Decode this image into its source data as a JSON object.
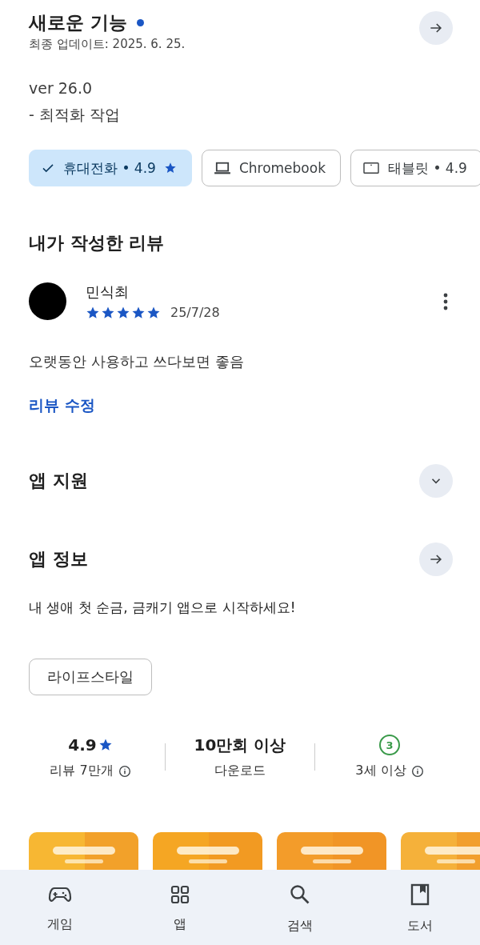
{
  "whats_new": {
    "title": "새로운 기능",
    "updated": "최종 업데이트: 2025. 6. 25.",
    "notes": [
      "ver 26.0",
      "- 최적화 작업"
    ]
  },
  "device_chips": [
    {
      "label": "휴대전화 • 4.9",
      "kind": "phone",
      "selected": true
    },
    {
      "label": "Chromebook",
      "kind": "laptop",
      "selected": false
    },
    {
      "label": "태블릿 • 4.9",
      "kind": "tablet",
      "selected": false
    }
  ],
  "my_review": {
    "heading": "내가 작성한 리뷰",
    "author": "민식최",
    "stars": 5,
    "date": "25/7/28",
    "text": "오랫동안 사용하고 쓰다보면 좋음",
    "edit_link": "리뷰 수정"
  },
  "sections": [
    {
      "title": "앱 지원",
      "kind": "expand"
    },
    {
      "title": "앱 정보",
      "kind": "arrow"
    }
  ],
  "description": "내 생애 첫 순금, 금캐기 앱으로 시작하세요!",
  "category_chip": "라이프스타일",
  "stats": [
    {
      "kind": "rating",
      "value": "4.9",
      "label": "리뷰 7만개"
    },
    {
      "kind": "plain",
      "value": "10만회 이상",
      "label": "다운로드"
    },
    {
      "kind": "age",
      "value": "3",
      "label": "3세 이상"
    }
  ],
  "bottom_nav": [
    {
      "label": "게임",
      "kind": "games",
      "selected": false
    },
    {
      "label": "앱",
      "kind": "apps",
      "selected": false
    },
    {
      "label": "검색",
      "kind": "search",
      "selected": false
    },
    {
      "label": "도서",
      "kind": "books",
      "selected": false
    }
  ]
}
